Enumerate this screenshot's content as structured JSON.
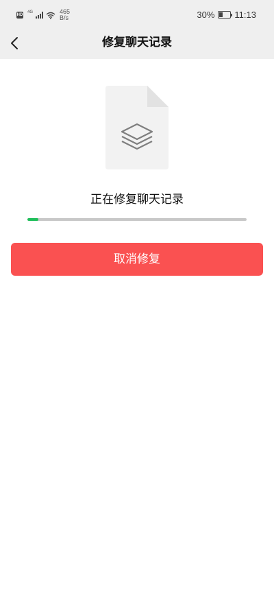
{
  "status_bar": {
    "hd_label": "HD",
    "cell_label": "4G",
    "speed_value": "465",
    "speed_unit": "B/s",
    "battery_percent": "30%",
    "battery_level": 0.3,
    "time": "11:13"
  },
  "nav": {
    "back_icon": "chevron-left-icon",
    "title": "修复聊天记录"
  },
  "illustration": {
    "icon": "layers-icon",
    "file_color": "#f2f2f2",
    "fold_color": "#e2e2e2",
    "layers_color": "#7f7f7f"
  },
  "repair": {
    "status_text": "正在修复聊天记录",
    "progress": 0.05,
    "progress_color": "#1fbf5a",
    "cancel_label": "取消修复",
    "cancel_color": "#fa5151"
  }
}
